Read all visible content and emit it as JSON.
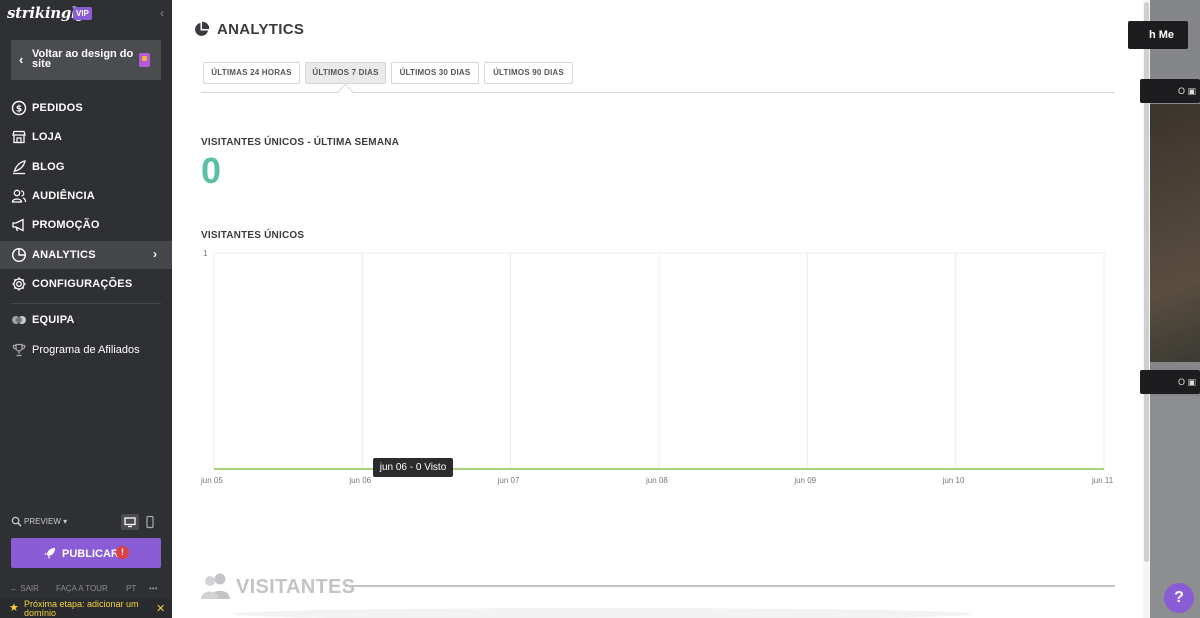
{
  "sidebar": {
    "logo": "strikingly",
    "vip_badge": "VIP",
    "back_button_label": "Voltar ao design do site",
    "nav": [
      {
        "label": "PEDIDOS",
        "icon": "dollar-circle-icon"
      },
      {
        "label": "LOJA",
        "icon": "store-icon"
      },
      {
        "label": "BLOG",
        "icon": "quill-icon"
      },
      {
        "label": "AUDIÊNCIA",
        "icon": "people-icon"
      },
      {
        "label": "PROMOÇÃO",
        "icon": "megaphone-icon"
      },
      {
        "label": "ANALYTICS",
        "icon": "pie-chart-icon",
        "active": true
      },
      {
        "label": "CONFIGURAÇÕES",
        "icon": "gear-icon"
      },
      {
        "label": "EQUIPA",
        "icon": "team-icon"
      },
      {
        "label": "Programa de Afiliados",
        "icon": "trophy-icon"
      }
    ],
    "preview_label": "PREVIEW",
    "publish_label": "PUBLICAR",
    "publish_alert": "!",
    "footer": {
      "exit": "SAIR",
      "tour": "FAÇA A TOUR",
      "lang": "PT",
      "more": "•••"
    },
    "next_step": "Próxima etapa: adicionar um domínio"
  },
  "main": {
    "title": "ANALYTICS",
    "tabs": [
      {
        "label": "ÚLTIMAS 24 HORAS"
      },
      {
        "label": "ÚLTIMOS 7 DIAS",
        "selected": true
      },
      {
        "label": "ÚLTIMOS 30 DIAS"
      },
      {
        "label": "ÚLTIMOS 90 DIAS"
      }
    ],
    "unique_week_label": "VISITANTES ÚNICOS - ÚLTIMA SEMANA",
    "unique_week_count": "0",
    "unique_chart_label": "VISITANTES ÚNICOS",
    "tooltip": "jun 06 - 0 Visto",
    "visitors_title": "VISITANTES"
  },
  "chart_data": {
    "type": "line",
    "categories": [
      "jun 05",
      "jun 06",
      "jun 07",
      "jun 08",
      "jun 09",
      "jun 10",
      "jun 11"
    ],
    "series": [
      {
        "values": [
          0,
          0,
          0,
          0,
          0,
          0,
          0
        ],
        "color": "#8cc152"
      }
    ],
    "ylim": [
      0,
      1
    ],
    "yticks": [
      "1"
    ],
    "grid": true
  },
  "backdrop": {
    "button_text": "h Me",
    "badge_text": "O"
  },
  "help_label": "?"
}
